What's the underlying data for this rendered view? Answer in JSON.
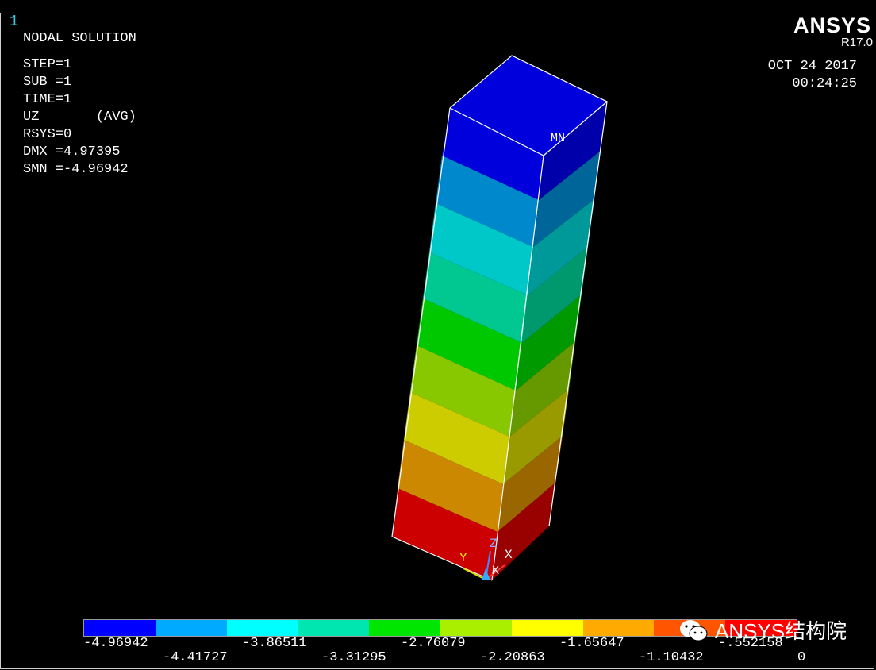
{
  "window": {
    "number": "1"
  },
  "info": {
    "title": "NODAL SOLUTION",
    "step": "STEP=1",
    "sub": "SUB =1",
    "time": "TIME=1",
    "result": "UZ       (AVG)",
    "rsys": "RSYS=0",
    "dmx": "DMX =4.97395",
    "smn": "SMN =-4.96942"
  },
  "brand": {
    "name": "ANSYS",
    "release": "R17.0"
  },
  "datetime": {
    "date": "OCT 24 2017",
    "time": "00:24:25"
  },
  "marker": {
    "min_label": "MN"
  },
  "triad": {
    "z": "Z",
    "x": "X",
    "y": "Y",
    "origin": "X"
  },
  "legend": {
    "colors": [
      "#0000ff",
      "#00aaff",
      "#00ffff",
      "#00e6b0",
      "#00e600",
      "#aaee00",
      "#ffff00",
      "#ffaa00",
      "#ff5500",
      "#ff0000"
    ],
    "upper_labels": [
      "-4.96942",
      "-3.86511",
      "-2.76079",
      "-1.65647",
      "-.552158"
    ],
    "lower_labels": [
      "-4.41727",
      "-3.31295",
      "-2.20863",
      "-1.10432",
      "0"
    ]
  },
  "watermark": {
    "text": "ANSYS结构院",
    "icon": "wechat-icon"
  }
}
